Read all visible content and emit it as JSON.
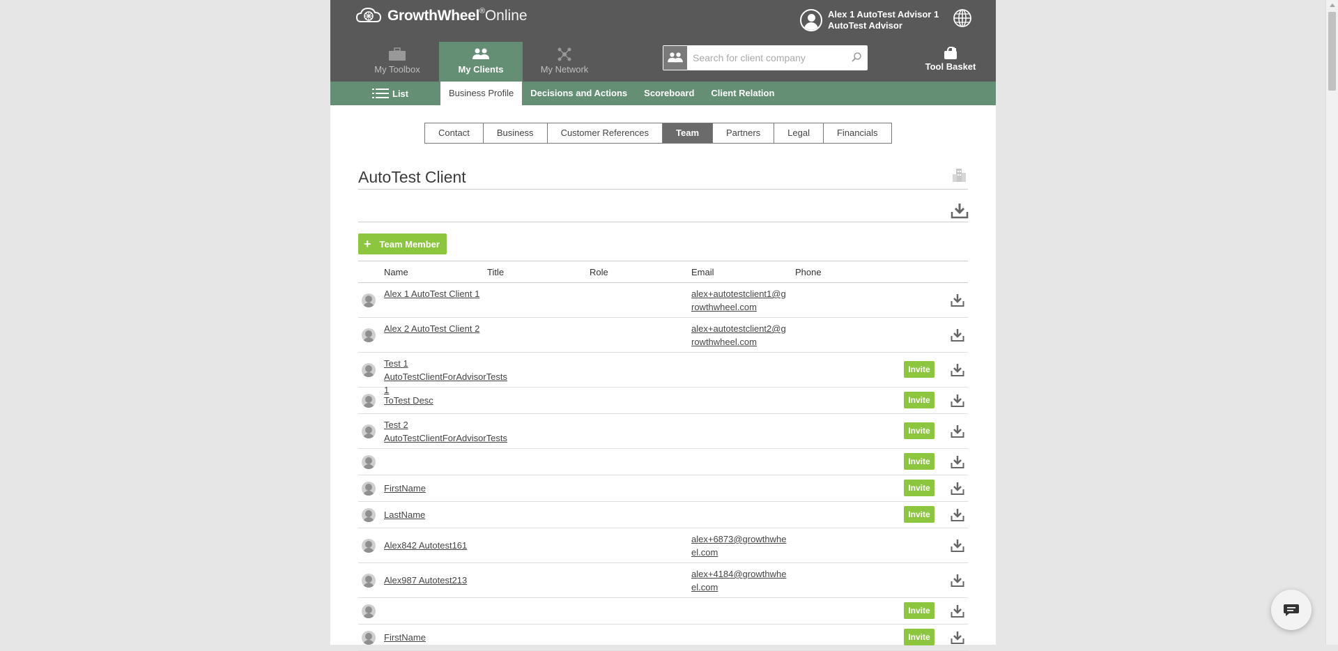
{
  "header": {
    "logo_name": "GrowthWheel",
    "logo_reg": "®",
    "logo_suffix": "Online",
    "user_name": "Alex 1 AutoTest Advisor 1",
    "user_role": "AutoTest Advisor"
  },
  "main_nav": [
    {
      "label": "My Toolbox",
      "icon": "briefcase-icon"
    },
    {
      "label": "My Clients",
      "icon": "clients-icon"
    },
    {
      "label": "My Network",
      "icon": "network-icon"
    }
  ],
  "search": {
    "placeholder": "Search for client company",
    "value": ""
  },
  "tool_basket": {
    "label": "Tool Basket"
  },
  "sub_nav": {
    "list_label": "List",
    "tabs": [
      "Business Profile",
      "Decisions and Actions",
      "Scoreboard",
      "Client Relation"
    ],
    "active": "Business Profile"
  },
  "section_tabs": {
    "items": [
      "Contact",
      "Business",
      "Customer References",
      "Team",
      "Partners",
      "Legal",
      "Financials"
    ],
    "active": "Team"
  },
  "company": {
    "title": "AutoTest Client"
  },
  "add_button": {
    "label": "Team Member"
  },
  "table": {
    "columns": [
      "Name",
      "Title",
      "Role",
      "Email",
      "Phone"
    ],
    "rows": [
      {
        "name": "Alex 1 AutoTest Client 1",
        "email": "alex+autotestclient1@growthwheel.com",
        "invite": false
      },
      {
        "name": "Alex 2 AutoTest Client 2",
        "email": "alex+autotestclient2@growthwheel.com",
        "invite": false
      },
      {
        "name": "Test 1 AutoTestClientForAdvisorTests 1",
        "email": "",
        "invite": true
      },
      {
        "name": "ToTest Desc",
        "email": "",
        "invite": true
      },
      {
        "name": "Test 2 AutoTestClientForAdvisorTests",
        "email": "",
        "invite": true
      },
      {
        "name": "",
        "email": "",
        "invite": true
      },
      {
        "name": "FirstName",
        "email": "",
        "invite": true
      },
      {
        "name": "LastName",
        "email": "",
        "invite": true
      },
      {
        "name": "Alex842 Autotest161",
        "email": "alex+6873@growthwheel.com",
        "invite": false
      },
      {
        "name": "Alex987 Autotest213",
        "email": "alex+4184@growthwheel.com",
        "invite": false
      },
      {
        "name": "",
        "email": "",
        "invite": true
      },
      {
        "name": "FirstName",
        "email": "",
        "invite": true
      }
    ],
    "invite_label": "Invite"
  },
  "colors": {
    "header_bg": "#595959",
    "nav_green": "#648f74",
    "accent_green": "#8cc63f"
  }
}
